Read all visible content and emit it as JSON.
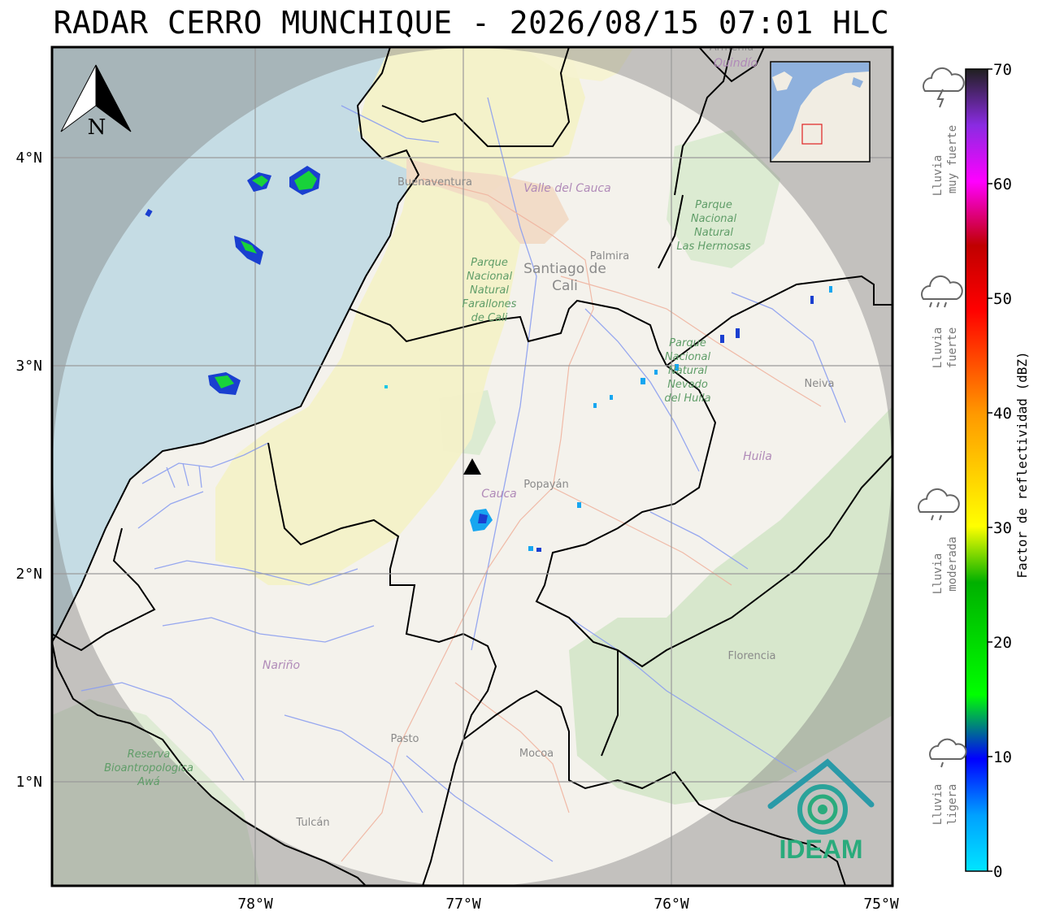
{
  "title": "RADAR CERRO MUNCHIQUE - 2026/08/15 07:01 HLC",
  "axes": {
    "x_ticks": [
      "78°W",
      "77°W",
      "76°W",
      "75°W"
    ],
    "y_ticks": [
      "4°N",
      "3°N",
      "2°N",
      "1°N"
    ]
  },
  "places": {
    "santiago_line1": "Santiago de",
    "santiago_line2": "Cali",
    "palmira": "Palmira",
    "buenaventura": "Buenaventura",
    "valle": "Valle del Cauca",
    "armenia": "Armenia",
    "quindio": "Quindío",
    "neiva": "Neiva",
    "huila": "Huila",
    "popayan": "Popayán",
    "cauca": "Cauca",
    "narino": "Nariño",
    "pasto": "Pasto",
    "mocoa": "Mocoa",
    "florencia": "Florencia",
    "tulcan": "Tulcán"
  },
  "parks": {
    "farallones": [
      "Parque",
      "Nacional",
      "Natural",
      "Farallones",
      "de Cali"
    ],
    "hermosas": [
      "Parque",
      "Nacional",
      "Natural",
      "Las Hermosas"
    ],
    "huila_park": [
      "Parque",
      "Nacional",
      "Natural",
      "Nevado",
      "del Huila"
    ],
    "awa": [
      "Reserva",
      "Bioantropologica",
      "Awá"
    ]
  },
  "north_arrow": "N",
  "logo": "IDEAM",
  "colorbar": {
    "title": "Factor de reflectividad (dBZ)",
    "ticks": [
      "0",
      "10",
      "20",
      "30",
      "40",
      "50",
      "60",
      "70"
    ],
    "stops": [
      "#00e5ff",
      "#00a0ff",
      "#0000ff",
      "#00ff00",
      "#00b000",
      "#ffff00",
      "#ff9900",
      "#ff0000",
      "#c00000",
      "#ff00ff",
      "#8a2be2",
      "#202020"
    ]
  },
  "rain_levels": [
    {
      "line1": "Lluvia",
      "line2": "muy fuerte",
      "icon": "thunderstorm-icon"
    },
    {
      "line1": "Lluvia",
      "line2": "fuerte",
      "icon": "heavy-rain-icon"
    },
    {
      "line1": "Lluvia",
      "line2": "moderada",
      "icon": "moderate-rain-icon"
    },
    {
      "line1": "Lluvia",
      "line2": "ligera",
      "icon": "light-rain-icon"
    }
  ]
}
